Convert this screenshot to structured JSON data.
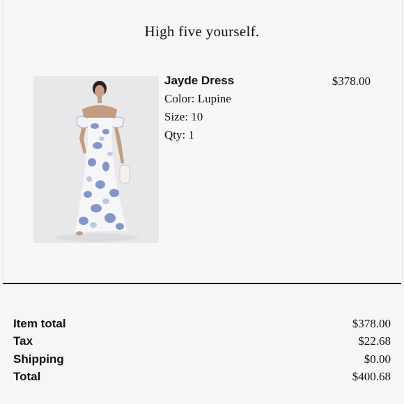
{
  "header": {
    "title": "High five yourself."
  },
  "order_item": {
    "name": "Jayde Dress",
    "color": "Color: Lupine",
    "size": "Size: 10",
    "qty": "Qty: 1",
    "price": "$378.00"
  },
  "summary": {
    "rows": [
      {
        "label": "Item total",
        "value": "$378.00"
      },
      {
        "label": "Tax",
        "value": "$22.68"
      },
      {
        "label": "Shipping",
        "value": "$0.00"
      },
      {
        "label": "Total",
        "value": "$400.68"
      }
    ]
  }
}
